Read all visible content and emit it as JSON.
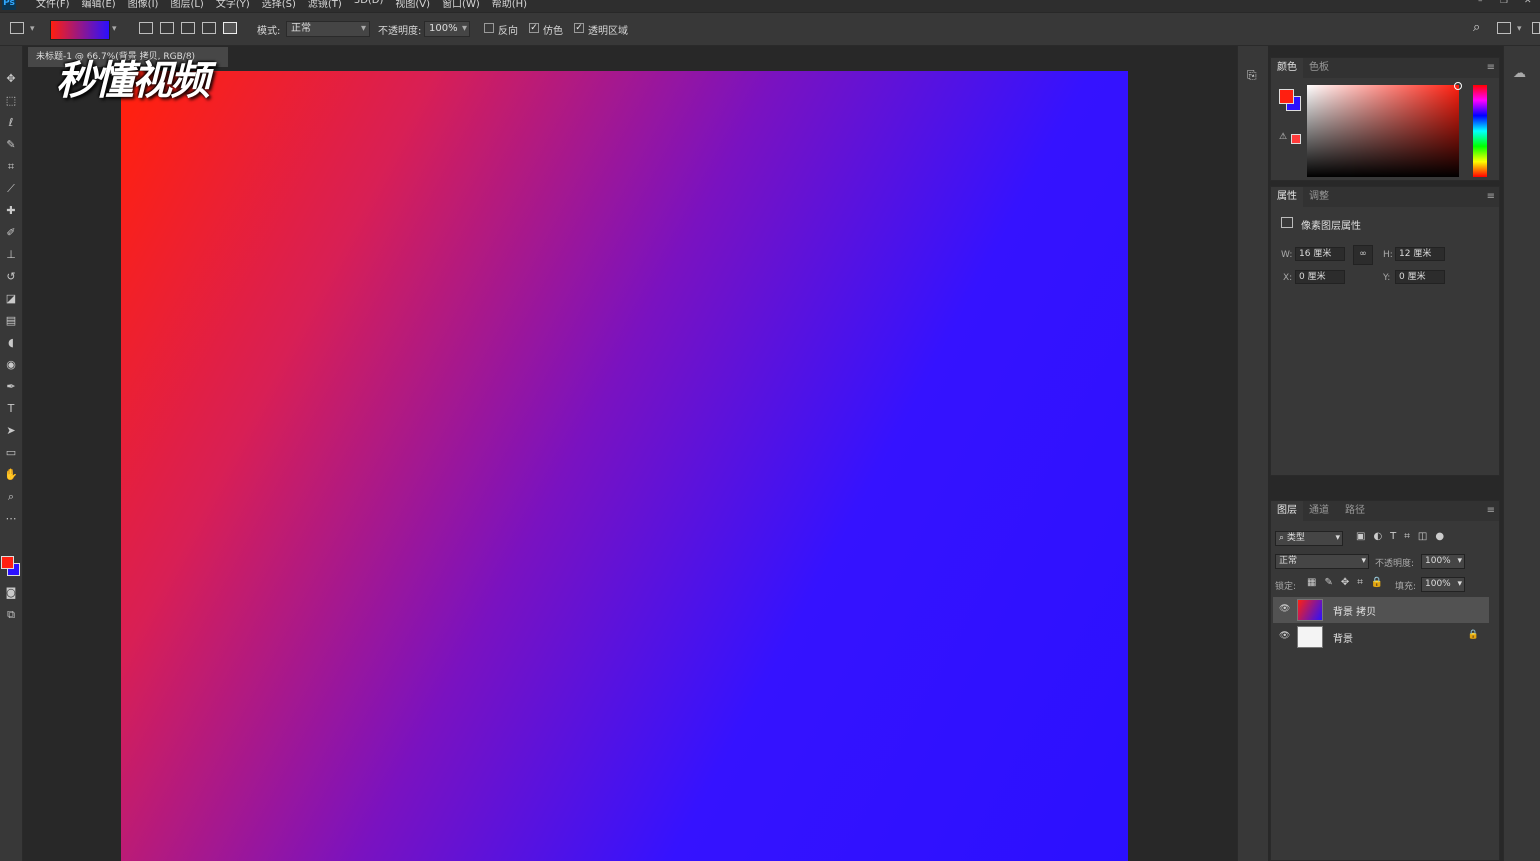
{
  "menu": {
    "logo": "Ps",
    "items": [
      "文件(F)",
      "编辑(E)",
      "图像(I)",
      "图层(L)",
      "文字(Y)",
      "选择(S)",
      "滤镜(T)",
      "3D(D)",
      "视图(V)",
      "窗口(W)",
      "帮助(H)"
    ]
  },
  "options": {
    "mode_label": "模式:",
    "mode_value": "正常",
    "opacity_label": "不透明度:",
    "opacity_value": "100%",
    "reverse_label": "反向",
    "dither_label": "仿色",
    "transparency_label": "透明区域",
    "reverse_checked": false,
    "dither_checked": true,
    "transparency_checked": true,
    "gradient_colors": [
      "#ff1f10",
      "#2b10ff"
    ]
  },
  "document": {
    "tab_title": "未标题-1 @ 66.7%(背景 拷贝, RGB/8)",
    "watermark": "秒懂视频",
    "gradient_start": "#ff2010",
    "gradient_end": "#2b10ff"
  },
  "tools": [
    "move-icon",
    "marquee-icon",
    "lasso-icon",
    "quick-select-icon",
    "crop-icon",
    "eyedropper-icon",
    "healing-icon",
    "brush-icon",
    "stamp-icon",
    "history-brush-icon",
    "eraser-icon",
    "gradient-icon",
    "blur-icon",
    "dodge-icon",
    "pen-icon",
    "type-icon",
    "path-select-icon",
    "rectangle-icon",
    "hand-icon",
    "zoom-icon",
    "more-icon"
  ],
  "color_panel": {
    "tabs": [
      "颜色",
      "色板"
    ],
    "foreground": "#ff1f10",
    "background": "#2b10ff"
  },
  "properties_panel": {
    "tabs": [
      "属性",
      "调整"
    ],
    "title": "像素图层属性",
    "w_label": "W:",
    "w_value": "16 厘米",
    "h_label": "H:",
    "h_value": "12 厘米",
    "x_label": "X:",
    "x_value": "0 厘米",
    "y_label": "Y:",
    "y_value": "0 厘米"
  },
  "layers_panel": {
    "tabs": [
      "图层",
      "通道",
      "路径"
    ],
    "filter_value": "类型",
    "blend_value": "正常",
    "opacity_label": "不透明度:",
    "opacity_value": "100%",
    "lock_label": "锁定:",
    "fill_label": "填充:",
    "fill_value": "100%",
    "layers": [
      {
        "name": "背景 拷贝",
        "selected": true,
        "locked": false
      },
      {
        "name": "背景",
        "selected": false,
        "locked": true
      }
    ]
  }
}
